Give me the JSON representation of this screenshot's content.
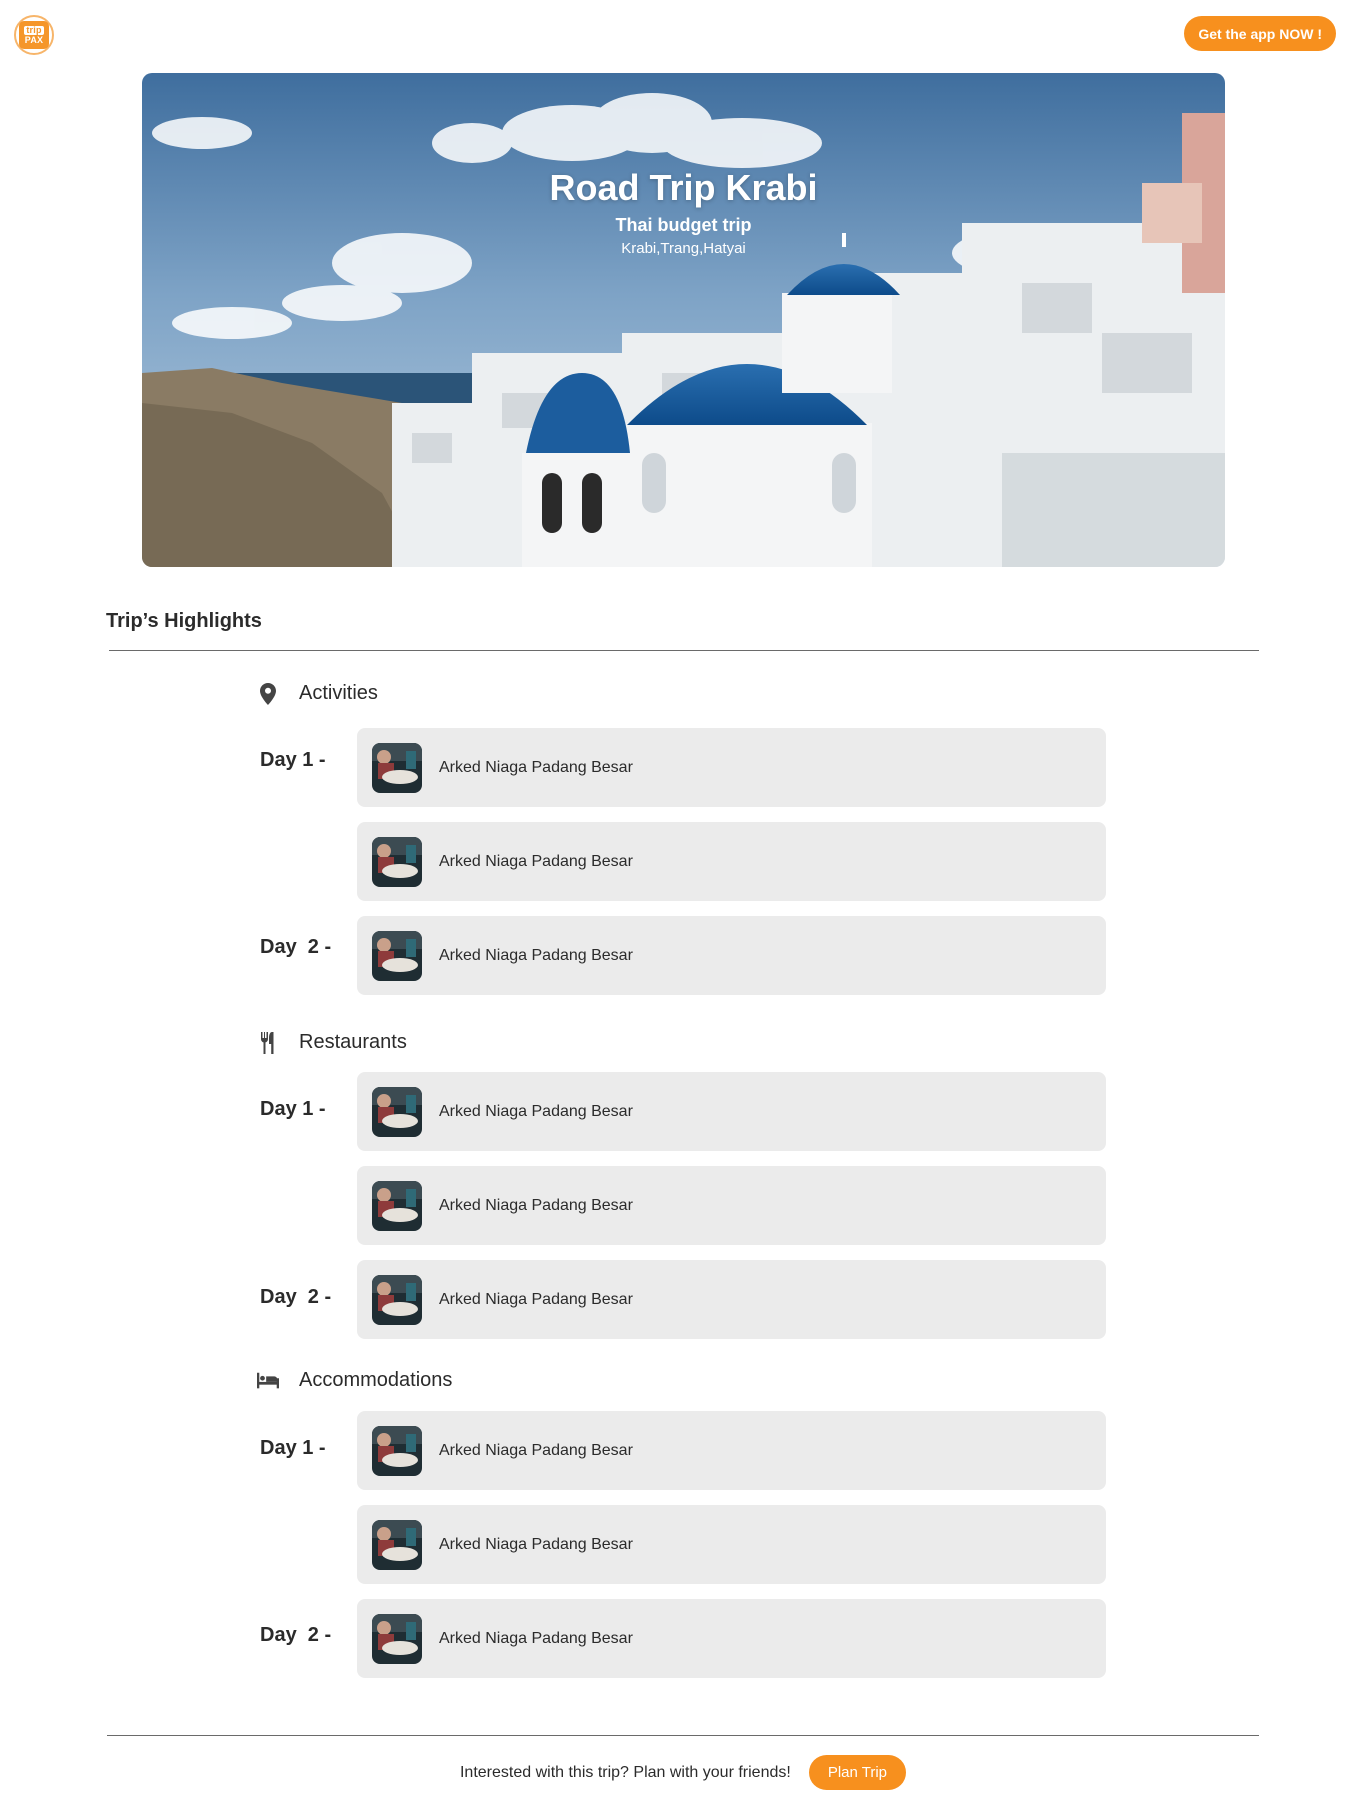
{
  "header": {
    "logo_text_top": "trip",
    "logo_text_bottom": "PAX",
    "get_app_label": "Get the app NOW !"
  },
  "hero": {
    "title": "Road Trip Krabi",
    "subtitle": "Thai budget trip",
    "places": "Krabi,Trang,Hatyai"
  },
  "highlights": {
    "title": "Trip’s Highlights",
    "categories": [
      {
        "name": "Activities",
        "icon": "map-pin-icon",
        "days": [
          {
            "label": "Day 1 -",
            "items": [
              "Arked Niaga Padang Besar",
              "Arked Niaga Padang Besar"
            ]
          },
          {
            "label": "Day  2 -",
            "items": [
              "Arked Niaga Padang Besar"
            ]
          }
        ]
      },
      {
        "name": "Restaurants",
        "icon": "fork-knife-icon",
        "days": [
          {
            "label": "Day 1 -",
            "items": [
              "Arked Niaga Padang Besar",
              "Arked Niaga Padang Besar"
            ]
          },
          {
            "label": "Day  2 -",
            "items": [
              "Arked Niaga Padang Besar"
            ]
          }
        ]
      },
      {
        "name": "Accommodations",
        "icon": "bed-icon",
        "days": [
          {
            "label": "Day 1 -",
            "items": [
              "Arked Niaga Padang Besar",
              "Arked Niaga Padang Besar"
            ]
          },
          {
            "label": "Day  2 -",
            "items": [
              "Arked Niaga Padang Besar"
            ]
          }
        ]
      }
    ]
  },
  "footer": {
    "text": "Interested with this trip? Plan with your friends!",
    "plan_label": "Plan Trip"
  },
  "colors": {
    "accent": "#f7901e",
    "card_bg": "#ebebeb",
    "text": "#2b2b2b"
  }
}
